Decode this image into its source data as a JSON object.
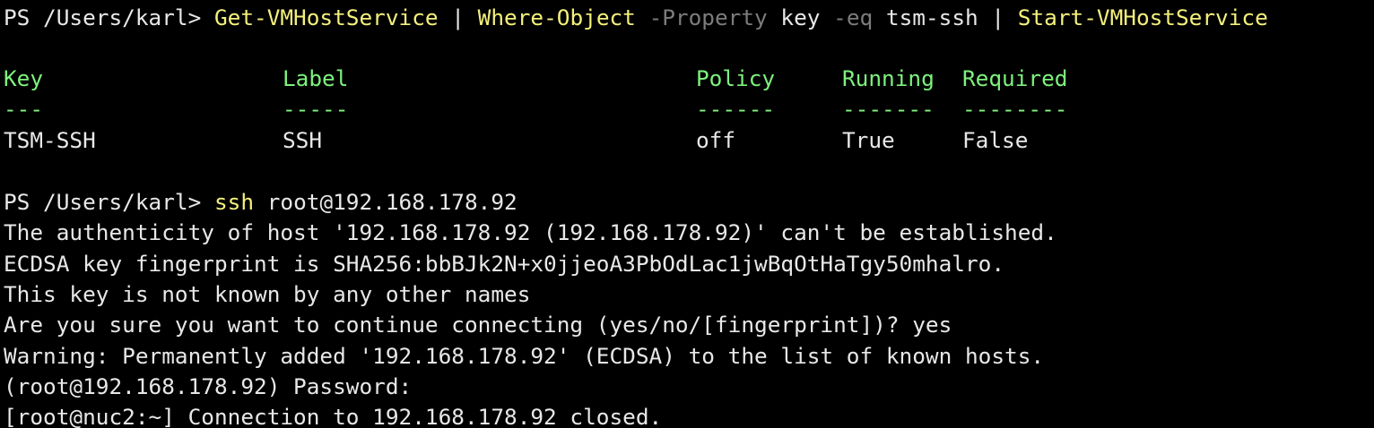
{
  "prompt": "PS /Users/karl> ",
  "command1": {
    "cmd1": "Get-VMHostService",
    "pipe1": " | ",
    "cmd2": "Where-Object",
    "sp1": " ",
    "param1": "-Property",
    "arg1": " key ",
    "param2": "-eq",
    "arg2": " tsm-ssh",
    "pipe2": " | ",
    "cmd3": "Start-VMHostService"
  },
  "table": {
    "headers": [
      "Key",
      "Label",
      "Policy",
      "Running",
      "Required"
    ],
    "separators": [
      "---",
      "-----",
      "------",
      "-------",
      "--------"
    ],
    "row": [
      "TSM-SSH",
      "SSH",
      "off",
      "True",
      "False"
    ]
  },
  "command2": {
    "cmd": "ssh",
    "arg": " root@192.168.178.92"
  },
  "output": [
    "The authenticity of host '192.168.178.92 (192.168.178.92)' can't be established.",
    "ECDSA key fingerprint is SHA256:bbBJk2N+x0jjeoA3PbOdLac1jwBqOtHaTgy50mhalro.",
    "This key is not known by any other names",
    "Are you sure you want to continue connecting (yes/no/[fingerprint])? yes",
    "Warning: Permanently added '192.168.178.92' (ECDSA) to the list of known hosts.",
    "(root@192.168.178.92) Password:",
    "[root@nuc2:~] Connection to 192.168.178.92 closed."
  ],
  "colors": {
    "background": "#000000",
    "text": "#e8e8e8",
    "cmdlet": "#f4f07c",
    "parameter": "#7c7c7c",
    "header": "#7df27d"
  }
}
